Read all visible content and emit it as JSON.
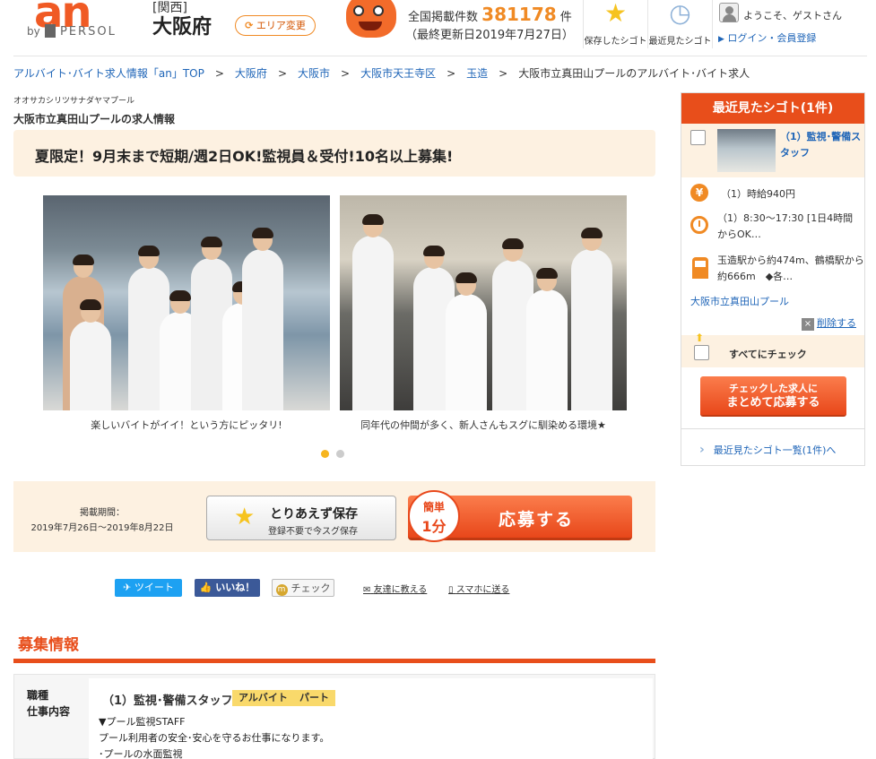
{
  "header": {
    "logo_text": "an",
    "logo_by": "by",
    "logo_brand": "PERSOL",
    "region": "[関西]",
    "prefecture": "大阪府",
    "area_change": "エリア変更",
    "count_label": "全国掲載件数",
    "count_value": "381178",
    "count_unit": "件",
    "updated": "（最終更新日2019年7月27日）",
    "saved_label": "保存したシゴト",
    "recent_label": "最近見たシゴト",
    "welcome": "ようこそ、ゲストさん",
    "login": "ログイン・会員登録"
  },
  "breadcrumb": {
    "items": [
      "アルバイト･バイト求人情報「an」TOP",
      "大阪府",
      "大阪市",
      "大阪市天王寺区",
      "玉造"
    ],
    "current": "大阪市立真田山プールのアルバイト･バイト求人",
    "separator": ">"
  },
  "main": {
    "store_kana": "オオサカシリツサナダヤマプール",
    "store_title": "大阪市立真田山プールの求人情報",
    "catch_copy": "夏限定！9月末まで短期/週2日OK!監視員＆受付!10名以上募集!",
    "photo_captions": [
      "楽しいバイトがイイ！という方にピッタリ!",
      "同年代の仲間が多く、新人さんもスグに馴染める環境★"
    ],
    "carousel_active": 1,
    "carousel_count": 2
  },
  "apply": {
    "period_label": "掲載期間：",
    "period_value": "2019年7月26日～2019年8月22日",
    "save_title": "とりあえず保存",
    "save_sub": "登録不要で今スグ保存",
    "bubble_top": "簡単",
    "bubble_bottom": "1分",
    "apply_label": "応募する"
  },
  "social": {
    "tweet": "ツイート",
    "like": "いいね！",
    "check": "チェック",
    "friend": "友達に教える",
    "mobile": "スマホに送る"
  },
  "recruit": {
    "section_title": "募集情報",
    "head_line1": "職種",
    "head_line2": "仕事内容",
    "job_title": "（1）監視･警備スタッフ",
    "tags": [
      "アルバイト",
      "パート"
    ],
    "desc_lines": [
      "▼プール監視STAFF",
      "プール利用者の安全･安心を守るお仕事になります。",
      "･プールの水面監視"
    ]
  },
  "sidebar": {
    "title": "最近見たシゴト(1件)",
    "job_name": "（1）監視･警備スタッフ",
    "wage": "（1）時給940円",
    "hours": "（1）8:30～17:30 [1日4時間からOK…",
    "access": "玉造駅から約474m、鶴橋駅から約666m　◆各…",
    "store": "大阪市立真田山プール",
    "delete": "削除する",
    "check_all": "すべてにチェック",
    "bulk_line1": "チェックした求人に",
    "bulk_line2": "まとめて応募する",
    "more": "最近見たシゴト一覧(1件)へ"
  },
  "colors": {
    "accent": "#e84e1b",
    "orange": "#f08a24",
    "link": "#2066b8",
    "highlight_bg": "#fdf1e1"
  }
}
